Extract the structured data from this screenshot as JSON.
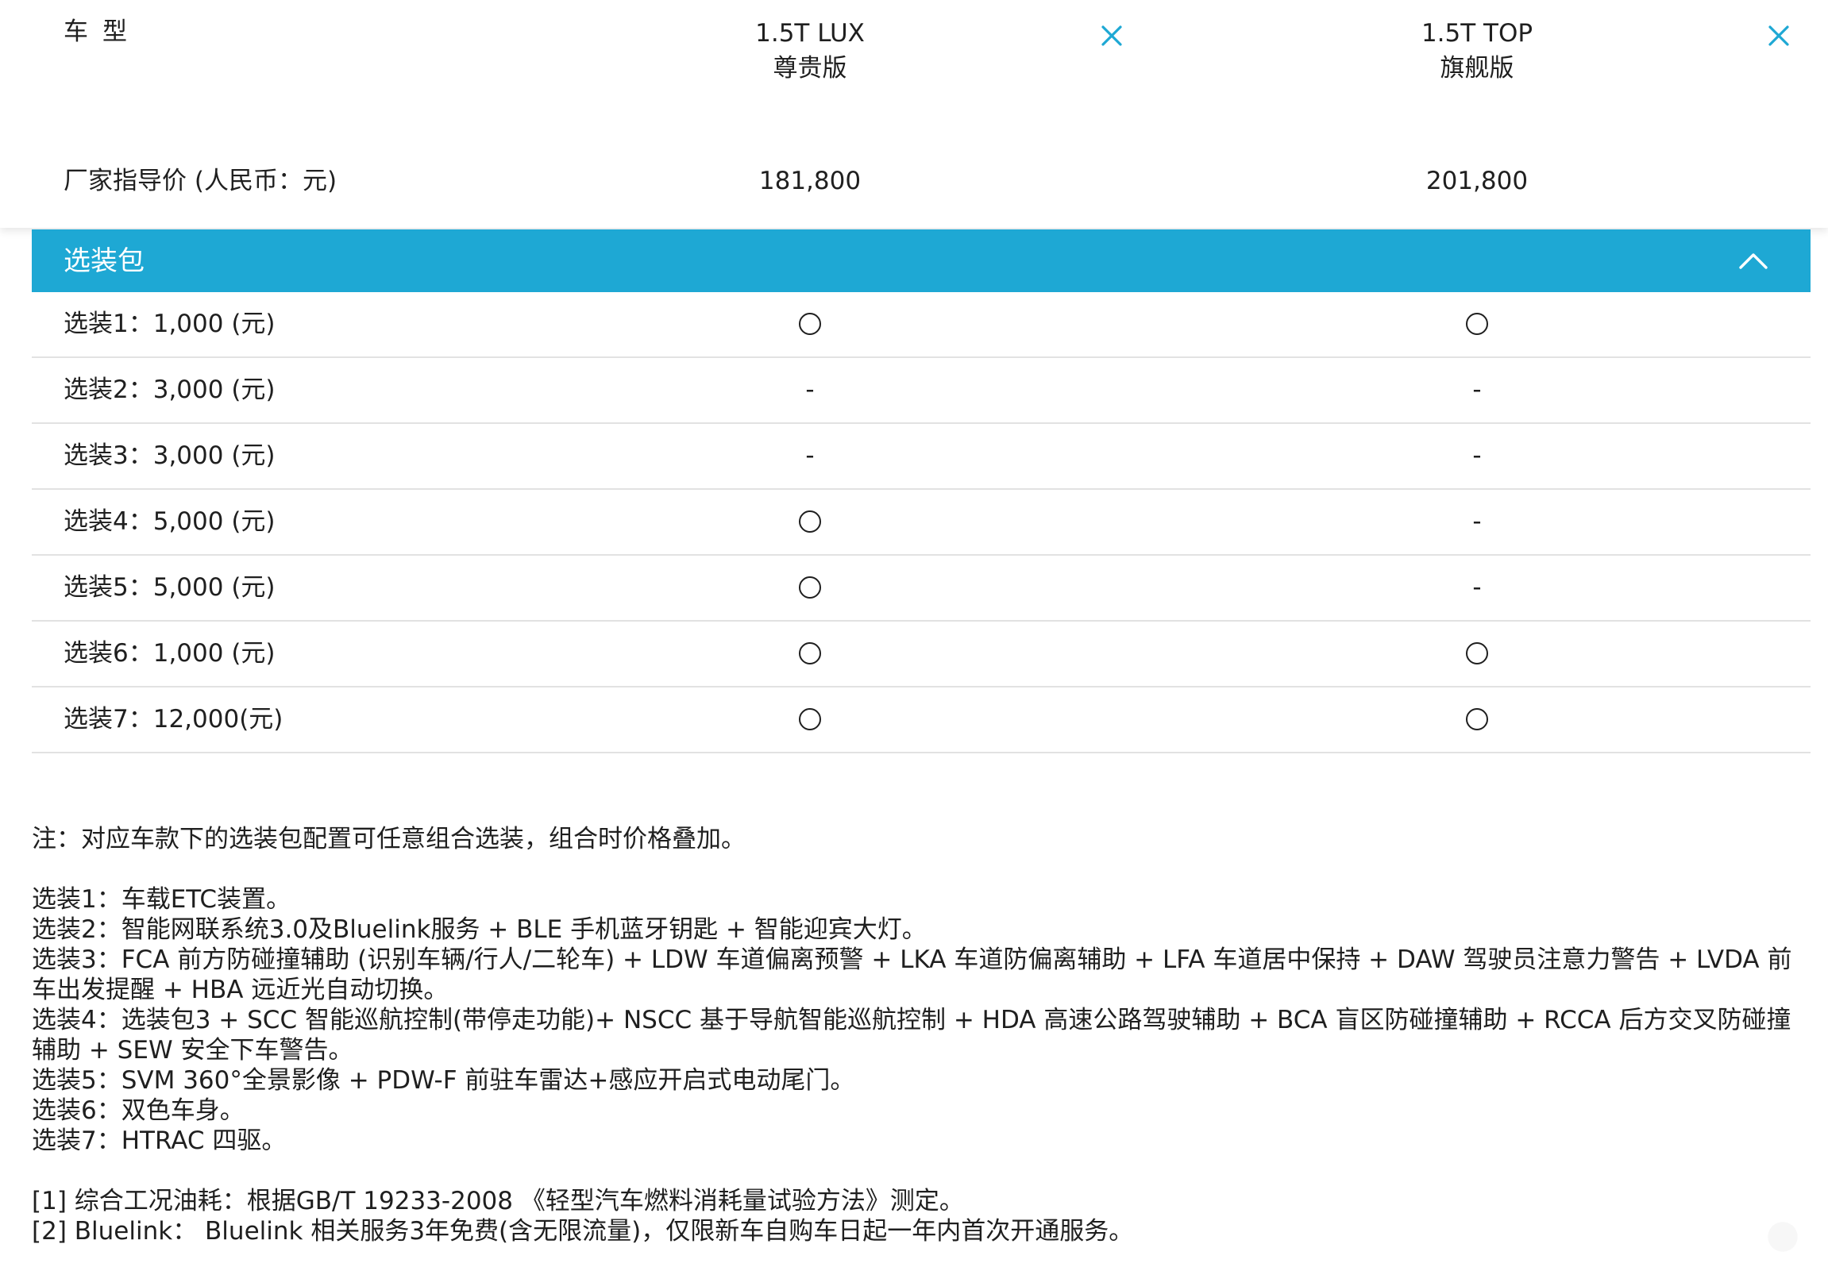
{
  "header": {
    "model_label": "车型",
    "price_label": "厂家指导价 (人民币：元)",
    "cars": [
      {
        "trim": "1.5T LUX",
        "edition": "尊贵版",
        "price": "181,800"
      },
      {
        "trim": "1.5T TOP",
        "edition": "旗舰版",
        "price": "201,800"
      }
    ],
    "icons": {
      "remove": "close-icon",
      "collapse": "chevron-up-icon"
    },
    "accent_color": "#1ea8d4"
  },
  "section": {
    "title": "选装包",
    "rows": [
      {
        "label": "选装1：1,000 (元)",
        "values": [
          "circle",
          "circle"
        ]
      },
      {
        "label": "选装2：3,000 (元)",
        "values": [
          "-",
          "-"
        ]
      },
      {
        "label": "选装3：3,000 (元)",
        "values": [
          "-",
          "-"
        ]
      },
      {
        "label": "选装4：5,000 (元)",
        "values": [
          "circle",
          "-"
        ]
      },
      {
        "label": "选装5：5,000 (元)",
        "values": [
          "circle",
          "-"
        ]
      },
      {
        "label": "选装6：1,000 (元)",
        "values": [
          "circle",
          "circle"
        ]
      },
      {
        "label": "选装7：12,000(元)",
        "values": [
          "circle",
          "circle"
        ]
      }
    ]
  },
  "notes": {
    "intro": "注：对应车款下的选装包配置可任意组合选装，组合时价格叠加。",
    "options": [
      "选装1：车载ETC装置。",
      "选装2：智能网联系统3.0及Bluelink服务 + BLE 手机蓝牙钥匙 + 智能迎宾大灯。",
      "选装3：FCA 前方防碰撞辅助 (识别车辆/行人/二轮车) + LDW 车道偏离预警 + LKA 车道防偏离辅助 + LFA 车道居中保持 + DAW 驾驶员注意力警告 + LVDA 前  车出发提醒 + HBA 远近光自动切换。",
      "选装4：选装包3 + SCC 智能巡航控制(带停走功能)+ NSCC 基于导航智能巡航控制 + HDA 高速公路驾驶辅助 + BCA 盲区防碰撞辅助 + RCCA 后方交叉防碰撞辅助 + SEW 安全下车警告。",
      "选装5：SVM 360°全景影像 + PDW-F 前驻车雷达+感应开启式电动尾门。",
      "选装6：双色车身。",
      "选装7：HTRAC 四驱。"
    ],
    "footnotes": [
      "[1] 综合工况油耗：根据GB/T 19233-2008 《轻型汽车燃料消耗量试验方法》测定。",
      "[2] Bluelink： Bluelink 相关服务3年免费(含无限流量)，仅限新车自购车日起一年内首次开通服务。"
    ]
  }
}
